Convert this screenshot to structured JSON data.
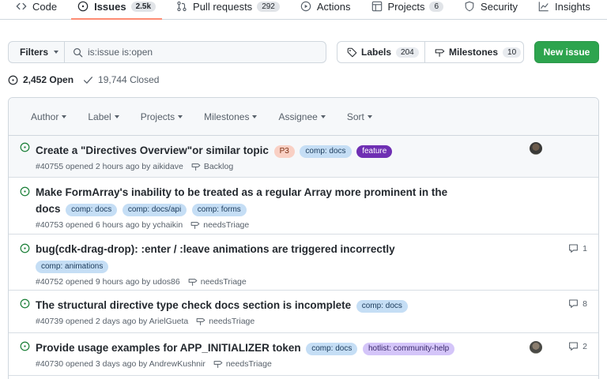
{
  "nav": {
    "tabs": [
      {
        "label": "Code",
        "count": null,
        "icon": "code-icon"
      },
      {
        "label": "Issues",
        "count": "2.5k",
        "icon": "issue-opened-icon"
      },
      {
        "label": "Pull requests",
        "count": "292",
        "icon": "git-pull-request-icon"
      },
      {
        "label": "Actions",
        "count": null,
        "icon": "play-icon"
      },
      {
        "label": "Projects",
        "count": "6",
        "icon": "table-icon"
      },
      {
        "label": "Security",
        "count": null,
        "icon": "shield-icon"
      },
      {
        "label": "Insights",
        "count": null,
        "icon": "graph-icon"
      }
    ],
    "selected": "Issues"
  },
  "filter_bar": {
    "filters_label": "Filters",
    "search_value": "is:issue is:open",
    "labels_label": "Labels",
    "labels_count": "204",
    "milestones_label": "Milestones",
    "milestones_count": "10",
    "new_issue_label": "New issue"
  },
  "states": {
    "open": "2,452 Open",
    "closed": "19,744 Closed"
  },
  "list_header": {
    "filters": [
      "Author",
      "Label",
      "Projects",
      "Milestones",
      "Assignee",
      "Sort"
    ]
  },
  "issues": [
    {
      "title": "Create a \"Directives Overview\"or similar topic",
      "labels": [
        {
          "text": "P3",
          "bg": "#f9d0c4",
          "fg": "#7a2e12"
        },
        {
          "text": "comp: docs",
          "bg": "#c5def5",
          "fg": "#1b3a5a"
        },
        {
          "text": "feature",
          "bg": "#6f2fb3",
          "fg": "#ffffff"
        }
      ],
      "meta": "#40755 opened 2 hours ago by aikidave",
      "milestone": "Backlog",
      "comments": null
    },
    {
      "title": "Make FormArray's inability to be treated as a regular Array more prominent in the docs",
      "title_line1": "Make FormArray's inability to be treated as a regular Array more prominent in the",
      "title_line2": "docs",
      "labels": [
        {
          "text": "comp: docs",
          "bg": "#c5def5",
          "fg": "#1b3a5a"
        },
        {
          "text": "comp: docs/api",
          "bg": "#c5def5",
          "fg": "#1b3a5a"
        },
        {
          "text": "comp: forms",
          "bg": "#c5def5",
          "fg": "#1b3a5a"
        }
      ],
      "meta": "#40753 opened 6 hours ago by ychaikin",
      "milestone": "needsTriage",
      "comments": null
    },
    {
      "title": "bug(cdk-drag-drop): :enter / :leave animations are triggered incorrectly",
      "labels": [
        {
          "text": "comp: animations",
          "bg": "#c5def5",
          "fg": "#1b3a5a"
        }
      ],
      "meta": "#40752 opened 9 hours ago by udos86",
      "milestone": "needsTriage",
      "comments": "1"
    },
    {
      "title": "The structural directive type check docs section is incomplete",
      "labels": [
        {
          "text": "comp: docs",
          "bg": "#c5def5",
          "fg": "#1b3a5a"
        }
      ],
      "meta": "#40739 opened 2 days ago by ArielGueta",
      "milestone": "needsTriage",
      "comments": "8"
    },
    {
      "title": "Provide usage examples for APP_INITIALIZER token",
      "labels": [
        {
          "text": "comp: docs",
          "bg": "#c5def5",
          "fg": "#1b3a5a"
        },
        {
          "text": "hotlist: community-help",
          "bg": "#d4c5f9",
          "fg": "#3b2a6b"
        }
      ],
      "meta": "#40730 opened 3 days ago by AndrewKushnir",
      "milestone": "needsTriage",
      "comments": "2"
    }
  ],
  "colors": {
    "open_green": "#1a7f37",
    "primary_button": "#2da44e",
    "selected_underline": "#fd8c73"
  }
}
